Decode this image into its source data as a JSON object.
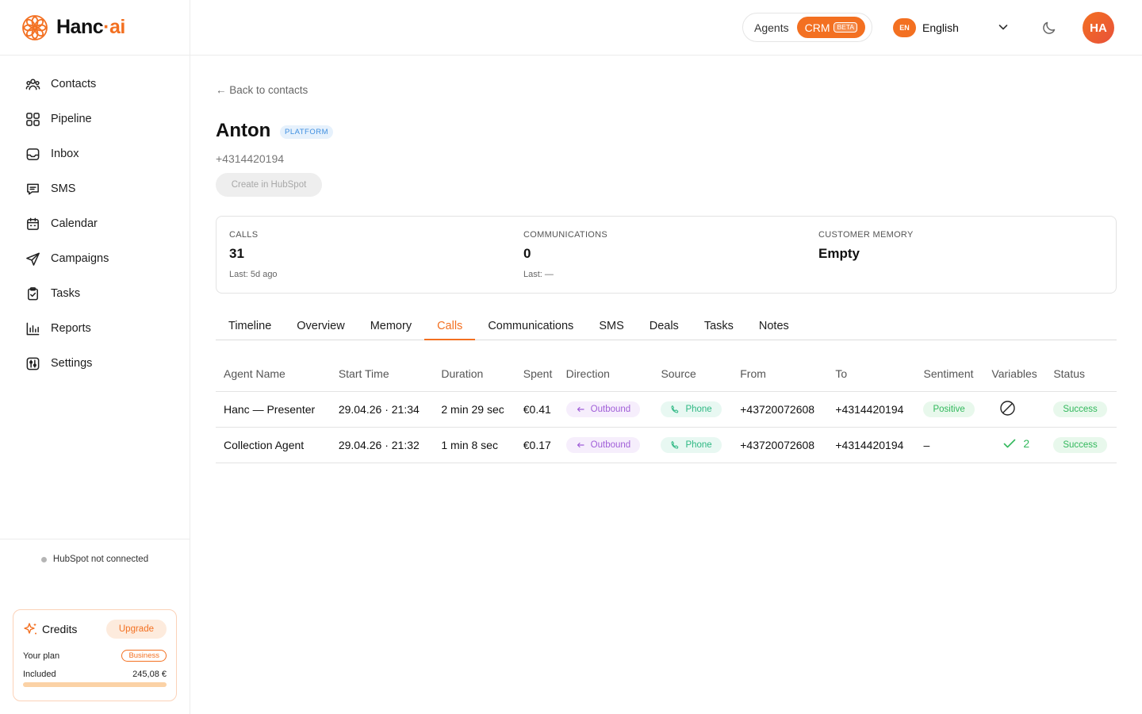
{
  "brand": {
    "name_main": "Hanc",
    "name_dot": "·",
    "name_suffix": "ai",
    "accent": "#f37021"
  },
  "sidebar": {
    "items": [
      {
        "label": "Contacts",
        "icon": "contacts-icon"
      },
      {
        "label": "Pipeline",
        "icon": "pipeline-icon"
      },
      {
        "label": "Inbox",
        "icon": "inbox-icon"
      },
      {
        "label": "SMS",
        "icon": "sms-icon"
      },
      {
        "label": "Calendar",
        "icon": "calendar-icon"
      },
      {
        "label": "Campaigns",
        "icon": "send-icon"
      },
      {
        "label": "Tasks",
        "icon": "clipboard-icon"
      },
      {
        "label": "Reports",
        "icon": "bar-chart-icon"
      },
      {
        "label": "Settings",
        "icon": "sliders-icon"
      }
    ],
    "hubspot_status": "HubSpot not connected",
    "credits": {
      "title": "Credits",
      "upgrade": "Upgrade",
      "plan_label": "Your plan",
      "plan_value": "Business",
      "included_label": "Included",
      "included_value": "245,08 €",
      "included_fraction": 1.0
    }
  },
  "topbar": {
    "mode_agents": "Agents",
    "mode_crm": "CRM",
    "beta": "BETA",
    "lang_code": "EN",
    "lang_label": "English",
    "avatar_initials": "HA"
  },
  "contact": {
    "back": "← Back to contacts",
    "name": "Anton",
    "badge": "PLATFORM",
    "phone": "+4314420194",
    "hubspot_button": "Create in HubSpot"
  },
  "stats": {
    "calls": {
      "label": "CALLS",
      "value": "31",
      "sub": "Last: 5d ago"
    },
    "communications": {
      "label": "COMMUNICATIONS",
      "value": "0",
      "sub": "Last: —"
    },
    "memory": {
      "label": "CUSTOMER MEMORY",
      "value": "Empty"
    }
  },
  "tabs": [
    "Timeline",
    "Overview",
    "Memory",
    "Calls",
    "Communications",
    "SMS",
    "Deals",
    "Tasks",
    "Notes"
  ],
  "active_tab": "Calls",
  "calls_table": {
    "headers": [
      "Agent Name",
      "Start Time",
      "Duration",
      "Spent",
      "Direction",
      "Source",
      "From",
      "To",
      "Sentiment",
      "Variables",
      "Status"
    ],
    "rows": [
      {
        "agent": "Hanc — Presenter",
        "start": "29.04.26 · 21:34",
        "duration": "2 min 29 sec",
        "spent": "€0.41",
        "direction": "Outbound",
        "source": "Phone",
        "from": "+43720072608",
        "to": "+4314420194",
        "sentiment": "Positive",
        "variables": "",
        "variables_icon": "none-icon",
        "status": "Success"
      },
      {
        "agent": "Collection Agent",
        "start": "29.04.26 · 21:32",
        "duration": "1 min 8 sec",
        "spent": "€0.17",
        "direction": "Outbound",
        "source": "Phone",
        "from": "+43720072608",
        "to": "+4314420194",
        "sentiment": "–",
        "variables": "2",
        "variables_icon": "check-icon",
        "status": "Success"
      }
    ]
  }
}
